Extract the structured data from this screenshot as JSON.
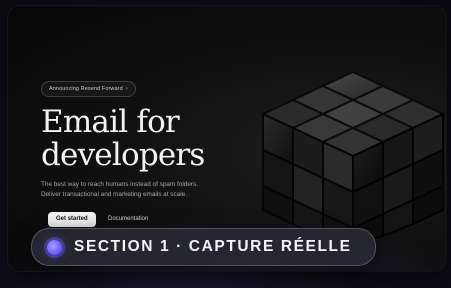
{
  "hero": {
    "badge_text": "Announcing Resend Forward",
    "badge_arrow": "›",
    "title_line1": "Email for",
    "title_line2": "developers",
    "subtitle_line1": "The best way to reach humans instead of spam folders.",
    "subtitle_line2": "Deliver transactional and marketing emails at scale.",
    "primary_button": "Get started",
    "secondary_button": "Documentation"
  },
  "overlay": {
    "section_label": "SECTION 1 · CAPTURE RÉELLE",
    "accent_color": "#6f63ff"
  },
  "decor": {
    "illustration": "rubiks-cube-icon"
  }
}
